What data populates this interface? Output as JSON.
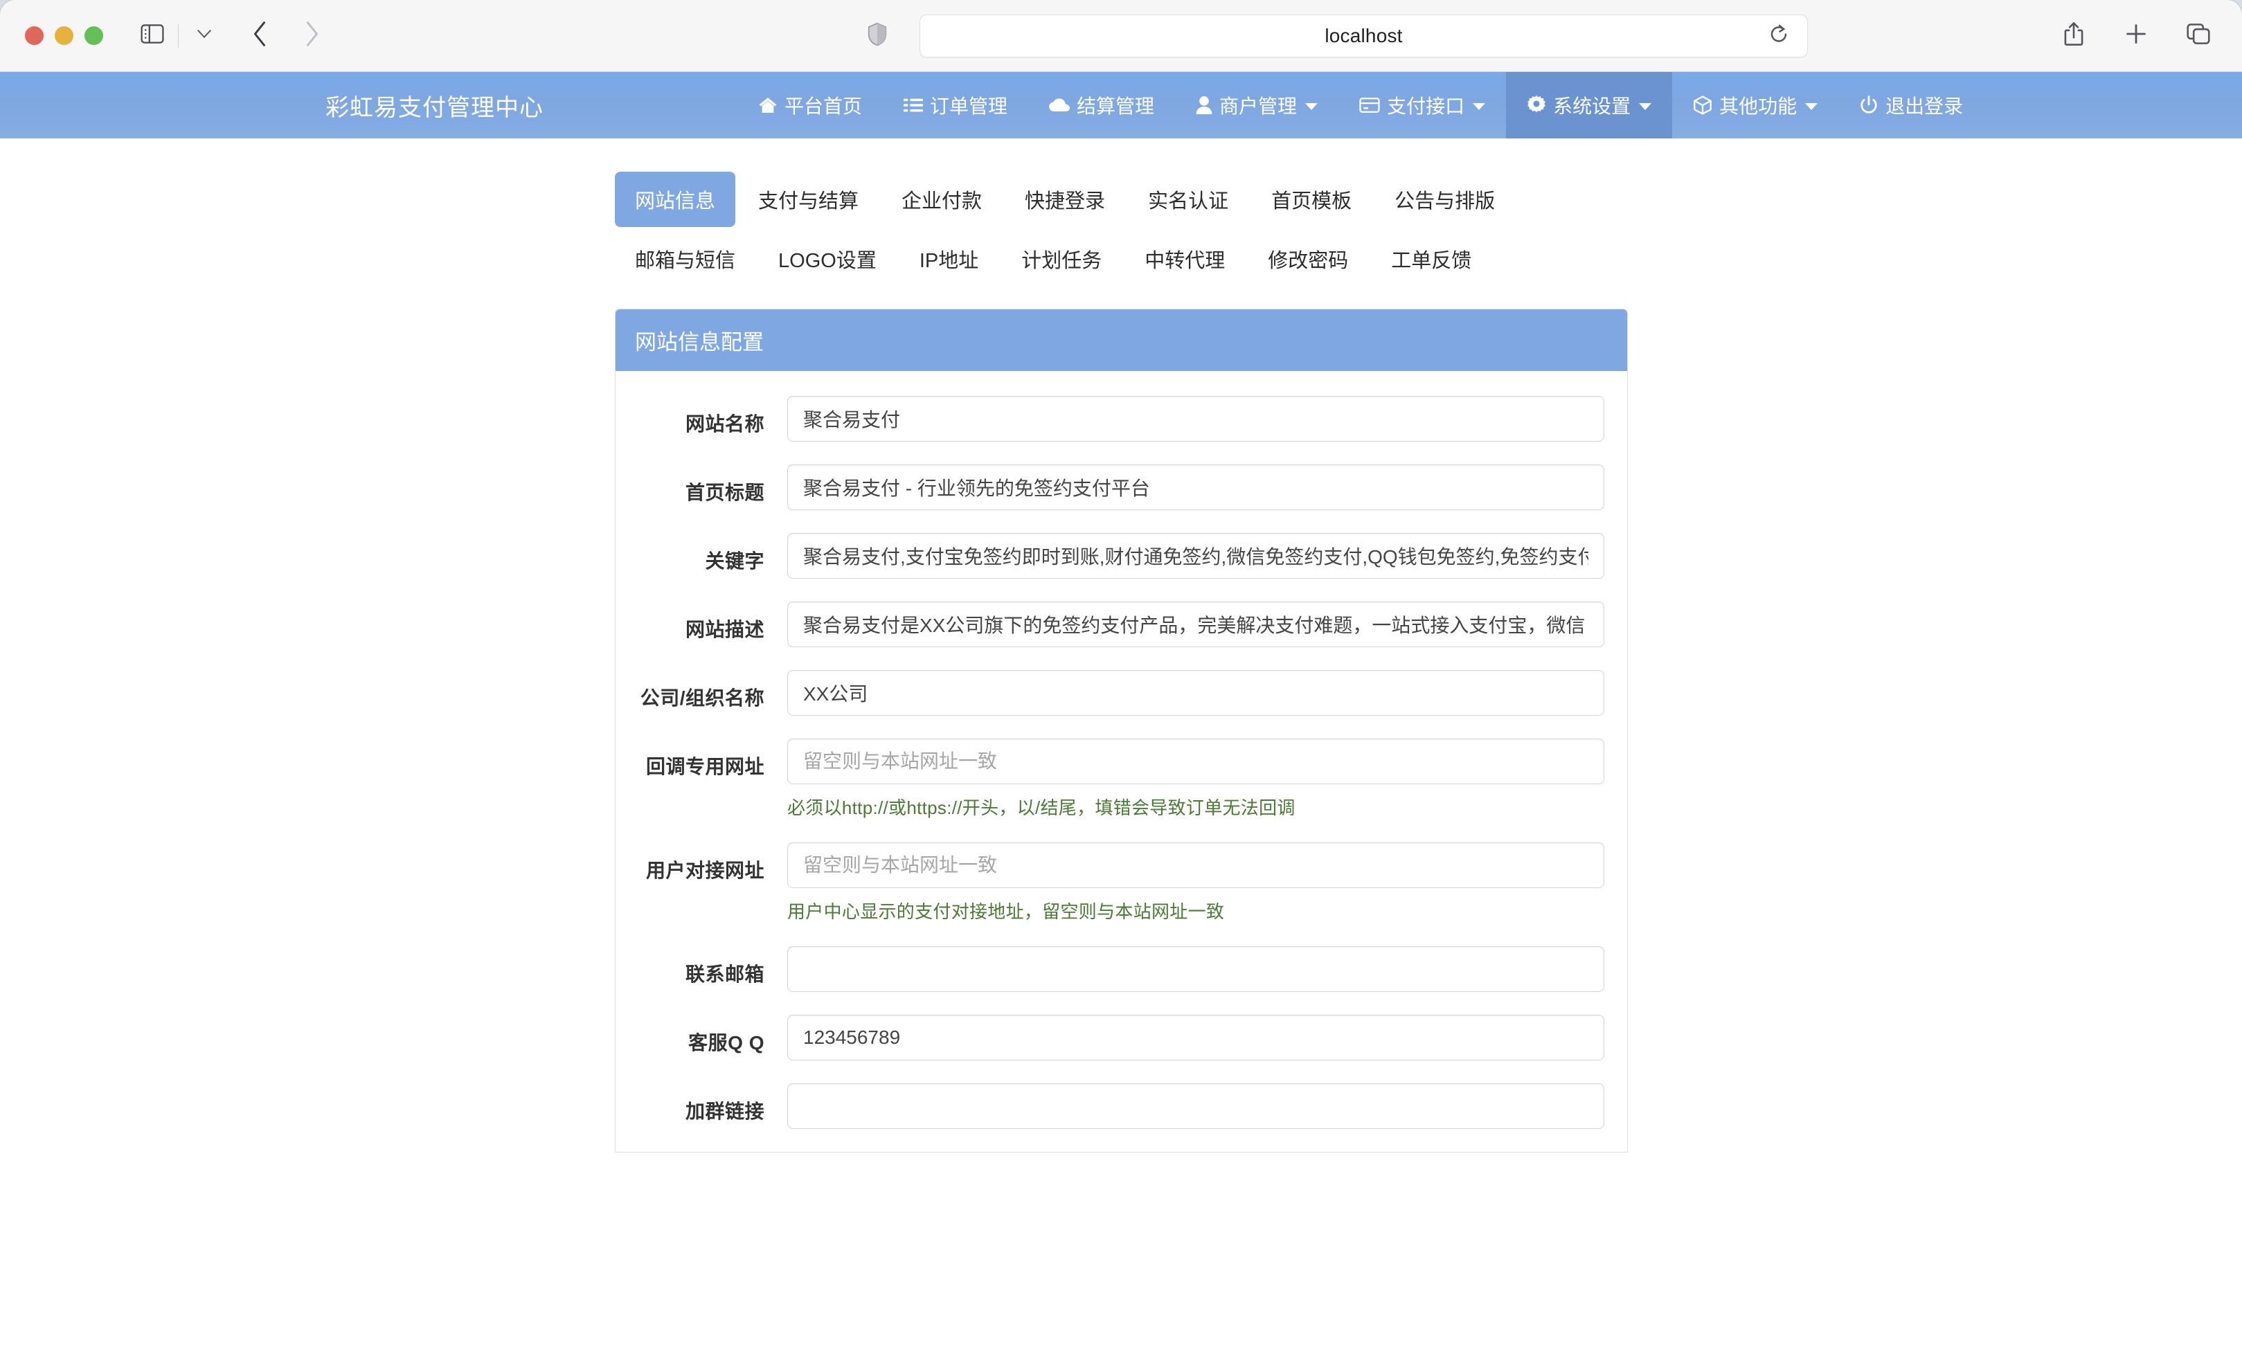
{
  "browser": {
    "url": "localhost",
    "icons": {
      "sidebar": "sidebar-icon",
      "sidebar_dropdown": "chevron-down-icon",
      "back": "back-chevron-icon",
      "forward": "forward-chevron-icon",
      "shield": "privacy-shield-icon",
      "reload": "reload-icon",
      "share": "share-icon",
      "new_tab": "plus-icon",
      "tab_overview": "tab-overview-icon"
    }
  },
  "navbar": {
    "brand": "彩虹易支付管理中心",
    "items": [
      {
        "label": "平台首页",
        "icon": "home-icon",
        "caret": false,
        "active": false
      },
      {
        "label": "订单管理",
        "icon": "list-icon",
        "caret": false,
        "active": false
      },
      {
        "label": "结算管理",
        "icon": "cloud-icon",
        "caret": false,
        "active": false
      },
      {
        "label": "商户管理",
        "icon": "user-icon",
        "caret": true,
        "active": false
      },
      {
        "label": "支付接口",
        "icon": "card-icon",
        "caret": true,
        "active": false
      },
      {
        "label": "系统设置",
        "icon": "gear-icon",
        "caret": true,
        "active": true
      },
      {
        "label": "其他功能",
        "icon": "cube-icon",
        "caret": true,
        "active": false
      },
      {
        "label": "退出登录",
        "icon": "power-icon",
        "caret": false,
        "active": false
      }
    ],
    "active_color": "#6a93cf",
    "background_color": "#7fa8e2"
  },
  "tabs": [
    {
      "label": "网站信息",
      "active": true
    },
    {
      "label": "支付与结算",
      "active": false
    },
    {
      "label": "企业付款",
      "active": false
    },
    {
      "label": "快捷登录",
      "active": false
    },
    {
      "label": "实名认证",
      "active": false
    },
    {
      "label": "首页模板",
      "active": false
    },
    {
      "label": "公告与排版",
      "active": false
    },
    {
      "label": "邮箱与短信",
      "active": false
    },
    {
      "label": "LOGO设置",
      "active": false
    },
    {
      "label": "IP地址",
      "active": false
    },
    {
      "label": "计划任务",
      "active": false
    },
    {
      "label": "中转代理",
      "active": false
    },
    {
      "label": "修改密码",
      "active": false
    },
    {
      "label": "工单反馈",
      "active": false
    }
  ],
  "panel": {
    "title": "网站信息配置",
    "fields": [
      {
        "label": "网站名称",
        "value": "聚合易支付",
        "placeholder": "",
        "help": ""
      },
      {
        "label": "首页标题",
        "value": "聚合易支付 - 行业领先的免签约支付平台",
        "placeholder": "",
        "help": ""
      },
      {
        "label": "关键字",
        "value": "聚合易支付,支付宝免签约即时到账,财付通免签约,微信免签约支付,QQ钱包免签约,免签约支付",
        "placeholder": "",
        "help": ""
      },
      {
        "label": "网站描述",
        "value": "聚合易支付是XX公司旗下的免签约支付产品，完美解决支付难题，一站式接入支付宝，微信",
        "placeholder": "",
        "help": ""
      },
      {
        "label": "公司/组织名称",
        "value": "XX公司",
        "placeholder": "",
        "help": ""
      },
      {
        "label": "回调专用网址",
        "value": "",
        "placeholder": "留空则与本站网址一致",
        "help": "必须以http://或https://开头，以/结尾，填错会导致订单无法回调"
      },
      {
        "label": "用户对接网址",
        "value": "",
        "placeholder": "留空则与本站网址一致",
        "help": "用户中心显示的支付对接地址，留空则与本站网址一致"
      },
      {
        "label": "联系邮箱",
        "value": "",
        "placeholder": "",
        "help": ""
      },
      {
        "label": "客服Q Q",
        "value": "123456789",
        "placeholder": "",
        "help": ""
      },
      {
        "label": "加群链接",
        "value": "",
        "placeholder": "",
        "help": ""
      }
    ]
  }
}
